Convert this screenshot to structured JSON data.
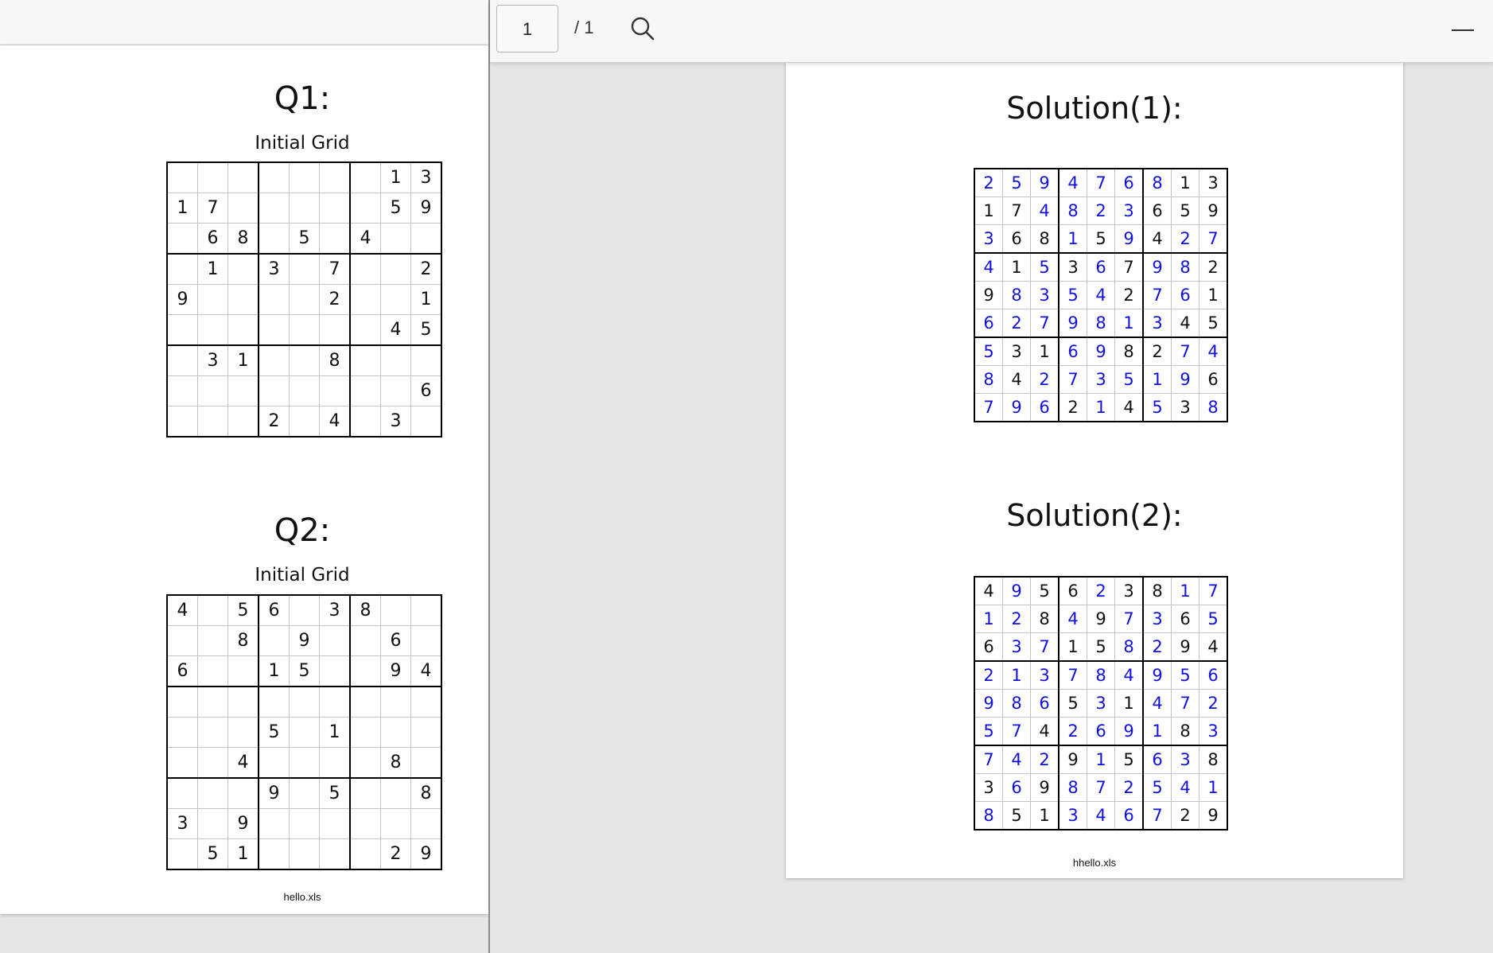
{
  "left_viewer": {
    "q1": {
      "title": "Q1:",
      "caption": "Initial Grid",
      "grid": [
        [
          "",
          "",
          "",
          "",
          "",
          "",
          "",
          "1",
          "3"
        ],
        [
          "1",
          "7",
          "",
          "",
          "",
          "",
          "",
          "5",
          "9"
        ],
        [
          "",
          "6",
          "8",
          "",
          "5",
          "",
          "4",
          "",
          ""
        ],
        [
          "",
          "1",
          "",
          "3",
          "",
          "7",
          "",
          "",
          "2"
        ],
        [
          "9",
          "",
          "",
          "",
          "",
          "2",
          "",
          "",
          "1"
        ],
        [
          "",
          "",
          "",
          "",
          "",
          "",
          "",
          "4",
          "5"
        ],
        [
          "",
          "3",
          "1",
          "",
          "",
          "8",
          "",
          "",
          ""
        ],
        [
          "",
          "",
          "",
          "",
          "",
          "",
          "",
          "",
          "6"
        ],
        [
          "",
          "",
          "",
          "2",
          "",
          "4",
          "",
          "3",
          ""
        ]
      ]
    },
    "q2": {
      "title": "Q2:",
      "caption": "Initial Grid",
      "grid": [
        [
          "4",
          "",
          "5",
          "6",
          "",
          "3",
          "8",
          "",
          ""
        ],
        [
          "",
          "",
          "8",
          "",
          "9",
          "",
          "",
          "6",
          ""
        ],
        [
          "6",
          "",
          "",
          "1",
          "5",
          "",
          "",
          "9",
          "4"
        ],
        [
          "",
          "",
          "",
          "",
          "",
          "",
          "",
          "",
          ""
        ],
        [
          "",
          "",
          "",
          "5",
          "",
          "1",
          "",
          "",
          ""
        ],
        [
          "",
          "",
          "4",
          "",
          "",
          "",
          "",
          "8",
          ""
        ],
        [
          "",
          "",
          "",
          "9",
          "",
          "5",
          "",
          "",
          "8"
        ],
        [
          "3",
          "",
          "9",
          "",
          "",
          "",
          "",
          "",
          ""
        ],
        [
          "",
          "5",
          "1",
          "",
          "",
          "",
          "",
          "2",
          "9"
        ]
      ]
    },
    "footer": "hello.xls"
  },
  "right_viewer": {
    "toolbar": {
      "page_number": "1",
      "page_total": "/ 1",
      "search_icon": "search-icon",
      "minimize_icon": "minimize-icon"
    },
    "solution1": {
      "title": "Solution(1):",
      "grid": [
        [
          "2",
          "5",
          "9",
          "4",
          "7",
          "6",
          "8",
          "1",
          "3"
        ],
        [
          "1",
          "7",
          "4",
          "8",
          "2",
          "3",
          "6",
          "5",
          "9"
        ],
        [
          "3",
          "6",
          "8",
          "1",
          "5",
          "9",
          "4",
          "2",
          "7"
        ],
        [
          "4",
          "1",
          "5",
          "3",
          "6",
          "7",
          "9",
          "8",
          "2"
        ],
        [
          "9",
          "8",
          "3",
          "5",
          "4",
          "2",
          "7",
          "6",
          "1"
        ],
        [
          "6",
          "2",
          "7",
          "9",
          "8",
          "1",
          "3",
          "4",
          "5"
        ],
        [
          "5",
          "3",
          "1",
          "6",
          "9",
          "8",
          "2",
          "7",
          "4"
        ],
        [
          "8",
          "4",
          "2",
          "7",
          "3",
          "5",
          "1",
          "9",
          "6"
        ],
        [
          "7",
          "9",
          "6",
          "2",
          "1",
          "4",
          "5",
          "3",
          "8"
        ]
      ],
      "blue_mask": [
        "111111100",
        "001111000",
        "100101011",
        "101010110",
        "011110110",
        "111111100",
        "100110011",
        "101111110",
        "111010101"
      ]
    },
    "solution2": {
      "title": "Solution(2):",
      "grid": [
        [
          "4",
          "9",
          "5",
          "6",
          "2",
          "3",
          "8",
          "1",
          "7"
        ],
        [
          "1",
          "2",
          "8",
          "4",
          "9",
          "7",
          "3",
          "6",
          "5"
        ],
        [
          "6",
          "3",
          "7",
          "1",
          "5",
          "8",
          "2",
          "9",
          "4"
        ],
        [
          "2",
          "1",
          "3",
          "7",
          "8",
          "4",
          "9",
          "5",
          "6"
        ],
        [
          "9",
          "8",
          "6",
          "5",
          "3",
          "1",
          "4",
          "7",
          "2"
        ],
        [
          "5",
          "7",
          "4",
          "2",
          "6",
          "9",
          "1",
          "8",
          "3"
        ],
        [
          "7",
          "4",
          "2",
          "9",
          "1",
          "5",
          "6",
          "3",
          "8"
        ],
        [
          "3",
          "6",
          "9",
          "8",
          "7",
          "2",
          "5",
          "4",
          "1"
        ],
        [
          "8",
          "5",
          "1",
          "3",
          "4",
          "6",
          "7",
          "2",
          "9"
        ]
      ],
      "blue_mask": [
        "010010011",
        "110101101",
        "011001100",
        "111111111",
        "111010111",
        "110111101",
        "111010110",
        "010111111",
        "100111100"
      ]
    },
    "footer": "hhello.xls",
    "colors": {
      "given": "#111111",
      "solved": "#1010e0"
    }
  }
}
